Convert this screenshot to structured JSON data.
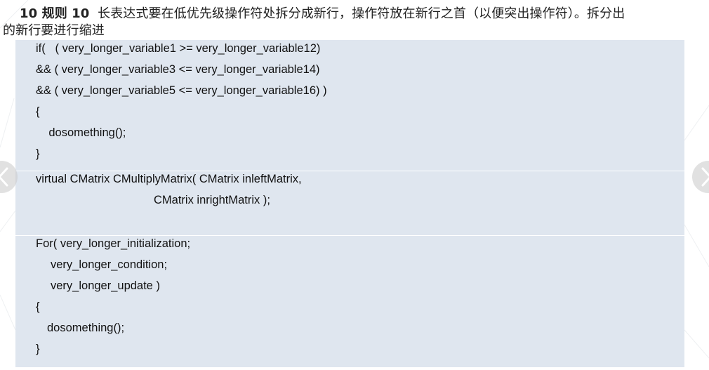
{
  "heading": {
    "rule_label": "10 规则 10",
    "text_line1": "长表达式要在低优先级操作符处拆分成新行，操作符放在新行之首（以便突出操作符）。拆分出",
    "text_line2": "的新行要进行缩进"
  },
  "code_blocks": [
    {
      "lines": [
        "if(   ( very_longer_variable1 >= very_longer_variable12)",
        "&& ( very_longer_variable3 <= very_longer_variable14)",
        "&& ( very_longer_variable5 <= very_longer_variable16) )",
        "{",
        "    dosomething();",
        "}"
      ]
    },
    {
      "lines": [
        "virtual CMatrix CMultiplyMatrix( CMatrix inleftMatrix,",
        "CMatrix inrightMatrix );",
        ""
      ]
    },
    {
      "lines": [
        "For( very_longer_initialization;",
        "very_longer_condition;",
        "very_longer_update )",
        "{",
        "dosomething();",
        "}"
      ]
    }
  ],
  "nav": {
    "prev_icon": "chevron-left-icon",
    "next_icon": "chevron-right-icon"
  },
  "colors": {
    "code_background": "#dfe6ef",
    "nav_button": "#c8c8c8"
  }
}
